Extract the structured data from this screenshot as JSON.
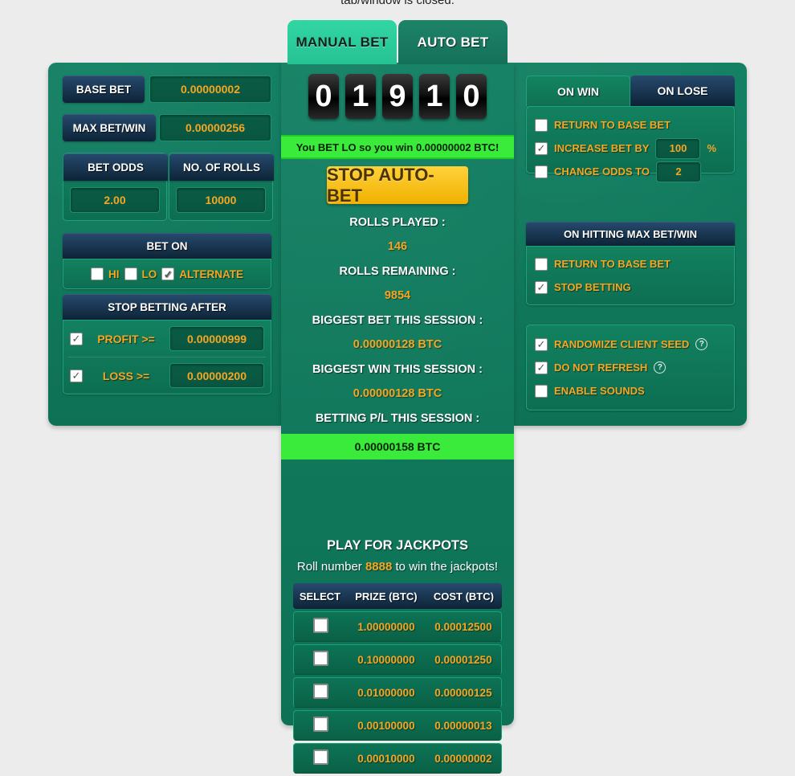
{
  "top_notice": "tab/window is closed.",
  "tabs": [
    {
      "label": "MANUAL BET",
      "active": true
    },
    {
      "label": "AUTO BET",
      "active": false
    }
  ],
  "left_panel": {
    "base_bet": {
      "label": "BASE BET",
      "value": "0.00000002"
    },
    "max_bet_win": {
      "label": "MAX BET/WIN",
      "value": "0.00000256"
    },
    "bet_odds": {
      "label": "BET ODDS",
      "value": "2.00"
    },
    "no_of_rolls": {
      "label": "NO. OF ROLLS",
      "value": "10000"
    },
    "bet_on": {
      "label": "BET ON",
      "options": [
        {
          "label": "HI",
          "checked": false
        },
        {
          "label": "LO",
          "checked": false
        },
        {
          "label": "ALTERNATE",
          "checked": true
        }
      ]
    },
    "stop_betting_after": {
      "label": "STOP BETTING AFTER",
      "rows": [
        {
          "label": "PROFIT >=",
          "value": "0.00000999",
          "checked": true
        },
        {
          "label": "LOSS >=",
          "value": "0.00000200",
          "checked": true
        }
      ]
    }
  },
  "center_panel": {
    "digits": [
      "0",
      "1",
      "9",
      "1",
      "0"
    ],
    "result_message": "You BET LO so you win 0.00000002 BTC!",
    "action_button": "STOP AUTO-BET",
    "stats": [
      {
        "label": "ROLLS PLAYED :",
        "value": "146"
      },
      {
        "label": "ROLLS REMAINING :",
        "value": "9854"
      },
      {
        "label": "BIGGEST BET THIS SESSION :",
        "value": "0.00000128 BTC"
      },
      {
        "label": "BIGGEST WIN THIS SESSION :",
        "value": "0.00000128 BTC"
      }
    ],
    "pl_label": "BETTING P/L THIS SESSION :",
    "pl_value": "0.00000158 BTC",
    "jackpot": {
      "title": "PLAY FOR JACKPOTS",
      "subtitle_pre": "Roll number ",
      "roll_number": "8888",
      "subtitle_post": " to win the jackpots!",
      "columns": [
        "SELECT",
        "PRIZE (BTC)",
        "COST (BTC)"
      ],
      "rows": [
        {
          "selected": false,
          "prize": "1.00000000",
          "cost": "0.00012500"
        },
        {
          "selected": false,
          "prize": "0.10000000",
          "cost": "0.00001250"
        },
        {
          "selected": false,
          "prize": "0.01000000",
          "cost": "0.00000125"
        },
        {
          "selected": false,
          "prize": "0.00100000",
          "cost": "0.00000013"
        },
        {
          "selected": false,
          "prize": "0.00010000",
          "cost": "0.00000002"
        }
      ]
    }
  },
  "right_panel": {
    "win_lose_tabs": [
      {
        "label": "ON WIN",
        "active": false
      },
      {
        "label": "ON LOSE",
        "active": true
      }
    ],
    "win_lose_options": [
      {
        "label": "RETURN TO BASE BET",
        "checked": false,
        "value": null,
        "suffix": null
      },
      {
        "label": "INCREASE BET BY",
        "checked": true,
        "value": "100",
        "suffix": "%"
      },
      {
        "label": "CHANGE ODDS TO",
        "checked": false,
        "value": "2",
        "suffix": null
      }
    ],
    "max_bet_win": {
      "label": "ON HITTING MAX BET/WIN",
      "options": [
        {
          "label": "RETURN TO BASE BET",
          "checked": false
        },
        {
          "label": "STOP BETTING",
          "checked": true
        }
      ]
    },
    "misc_options": [
      {
        "label": "RANDOMIZE CLIENT SEED",
        "checked": true,
        "help": "?"
      },
      {
        "label": "DO NOT REFRESH",
        "checked": true,
        "help": "?"
      },
      {
        "label": "ENABLE SOUNDS",
        "checked": false,
        "help": null
      }
    ]
  },
  "colors": {
    "panel_green": "#0e7155",
    "navy_label": "#0d2437",
    "gold_text": "#f5a623",
    "bright_green": "#3beb3b",
    "yellow_button": "#f0b000",
    "tab_active": "#27c294"
  }
}
